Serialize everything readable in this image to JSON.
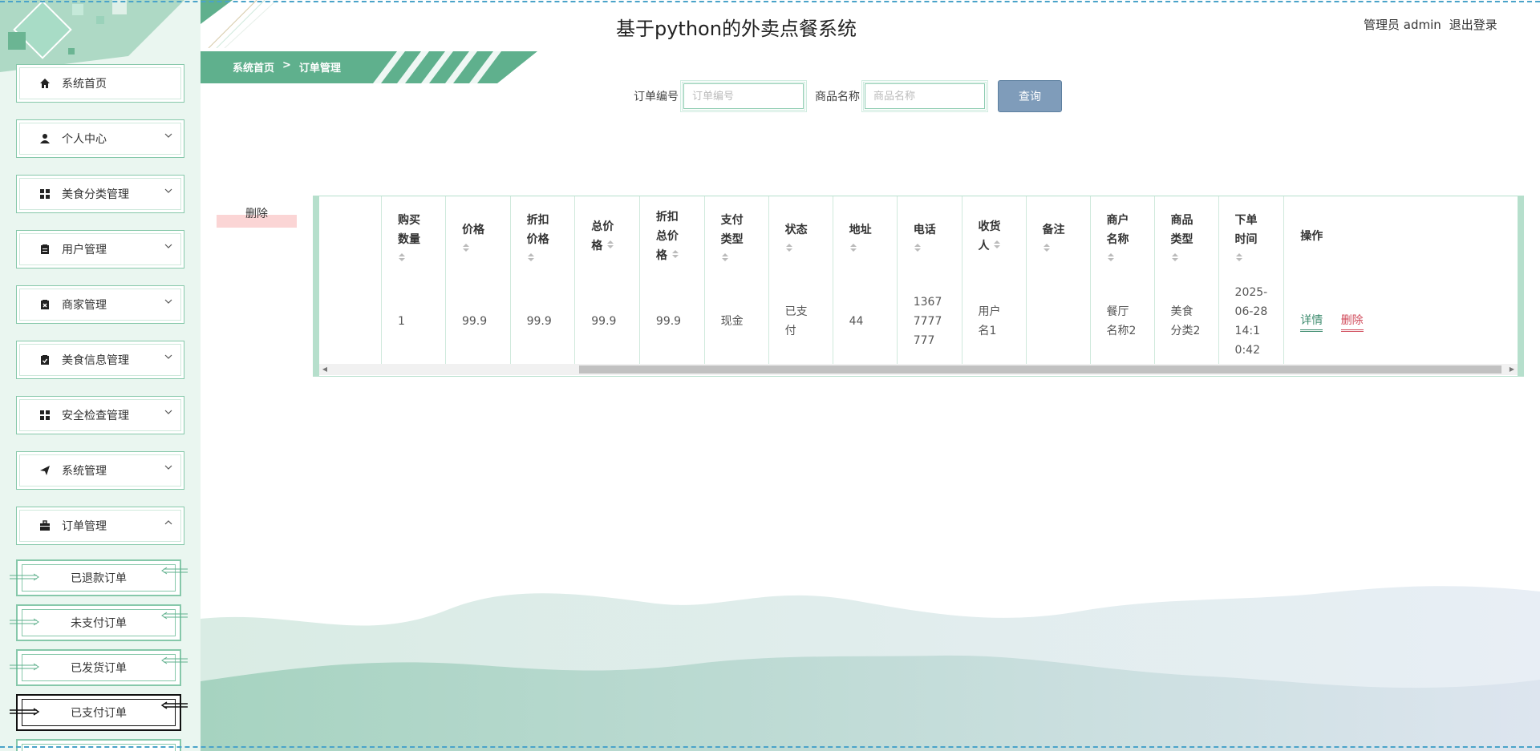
{
  "app": {
    "title": "基于python的外卖点餐系统"
  },
  "user": {
    "label": "管理员 admin",
    "logout": "退出登录"
  },
  "breadcrumb": {
    "home": "系统首页",
    "separator": ">",
    "current": "订单管理"
  },
  "sidebar": {
    "items": [
      {
        "label": "系统首页",
        "icon": "home-icon"
      },
      {
        "label": "个人中心",
        "icon": "user-icon"
      },
      {
        "label": "美食分类管理",
        "icon": "grid-icon"
      },
      {
        "label": "用户管理",
        "icon": "clipboard-icon"
      },
      {
        "label": "商家管理",
        "icon": "clipboard-x-icon"
      },
      {
        "label": "美食信息管理",
        "icon": "clipboard-check-icon"
      },
      {
        "label": "安全检查管理",
        "icon": "grid-icon"
      },
      {
        "label": "系统管理",
        "icon": "send-icon"
      },
      {
        "label": "订单管理",
        "icon": "briefcase-icon"
      }
    ],
    "subitems": [
      {
        "label": "已退款订单"
      },
      {
        "label": "未支付订单"
      },
      {
        "label": "已发货订单"
      },
      {
        "label": "已支付订单"
      }
    ]
  },
  "search": {
    "order_no_label": "订单编号",
    "order_no_placeholder": "订单编号",
    "product_label": "商品名称",
    "product_placeholder": "商品名称",
    "query_button": "查询"
  },
  "actions": {
    "bulk_delete": "删除"
  },
  "table": {
    "columns": [
      {
        "l1": "购买",
        "l2": "数量"
      },
      {
        "l1": "价格",
        "l2": ""
      },
      {
        "l1": "折扣",
        "l2": "价格"
      },
      {
        "l1": "总价",
        "l2": "格"
      },
      {
        "l1": "折扣",
        "l2": "总价",
        "l3": "格"
      },
      {
        "l1": "支付",
        "l2": "类型"
      },
      {
        "l1": "状态",
        "l2": ""
      },
      {
        "l1": "地址",
        "l2": ""
      },
      {
        "l1": "电话",
        "l2": ""
      },
      {
        "l1": "收货",
        "l2": "人"
      },
      {
        "l1": "备注",
        "l2": ""
      },
      {
        "l1": "商户",
        "l2": "名称"
      },
      {
        "l1": "商品",
        "l2": "类型"
      },
      {
        "l1": "下单",
        "l2": "时间"
      },
      {
        "l1": "操作"
      }
    ],
    "row": {
      "qty": "1",
      "price": "99.9",
      "discount_price": "99.9",
      "total_price": "99.9",
      "discount_total": "99.9",
      "pay_type": "现金",
      "status_l1": "已支",
      "status_l2": "付",
      "address": "44",
      "phone_l1": "1367",
      "phone_l2": "7777",
      "phone_l3": "777",
      "receiver_l1": "用户",
      "receiver_l2": "名1",
      "remark": "",
      "merchant_l1": "餐厅",
      "merchant_l2": "名称2",
      "category_l1": "美食",
      "category_l2": "分类2",
      "time_l1": "2025-",
      "time_l2": "06-28",
      "time_l3": "14:1",
      "time_l4": "0:42",
      "detail_btn": "详情",
      "delete_btn": "删除"
    }
  },
  "colors": {
    "accent": "#5fb08d",
    "sidebar_bg": "#eaf6f0",
    "query_btn": "#7f9cba",
    "delete_text": "#d04a5a"
  }
}
